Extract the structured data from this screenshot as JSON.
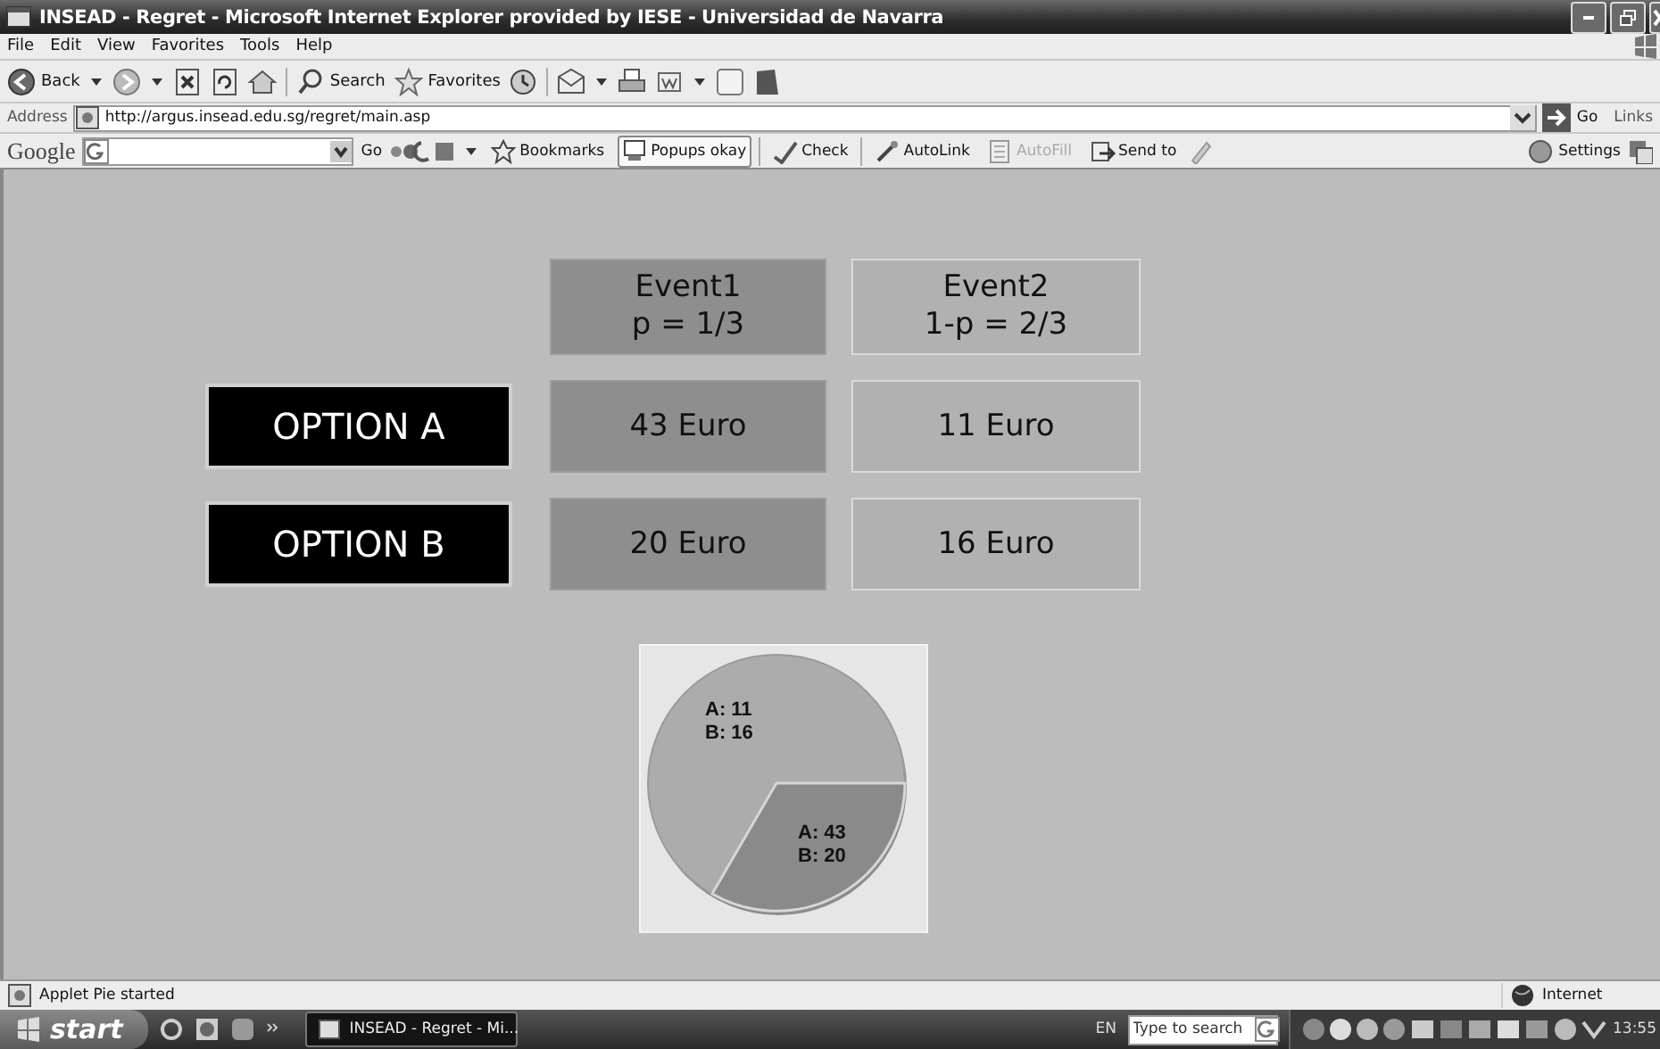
{
  "window": {
    "title": "INSEAD - Regret - Microsoft Internet Explorer provided by IESE - Universidad de Navarra"
  },
  "menu_bar": [
    "File",
    "Edit",
    "View",
    "Favorites",
    "Tools",
    "Help"
  ],
  "toolbar": {
    "back": "Back",
    "search": "Search",
    "favorites": "Favorites"
  },
  "address_bar": {
    "label": "Address",
    "url": "http://argus.insead.edu.sg/regret/main.asp",
    "go": "Go",
    "links": "Links"
  },
  "google_bar": {
    "logo": "Google",
    "go": "Go",
    "items": [
      {
        "label": "Bookmarks",
        "disabled": false,
        "selected": false
      },
      {
        "label": "Popups okay",
        "disabled": false,
        "selected": true
      },
      {
        "label": "Check",
        "disabled": false,
        "selected": false
      },
      {
        "label": "AutoLink",
        "disabled": false,
        "selected": false
      },
      {
        "label": "AutoFill",
        "disabled": true,
        "selected": false
      },
      {
        "label": "Send to",
        "disabled": false,
        "selected": false
      }
    ],
    "settings": "Settings"
  },
  "decision": {
    "events": [
      {
        "name": "Event1",
        "probability": "p = 1/3"
      },
      {
        "name": "Event2",
        "probability": "1-p = 2/3"
      }
    ],
    "options": [
      {
        "label": "OPTION A",
        "payoffs": [
          "43 Euro",
          "11 Euro"
        ]
      },
      {
        "label": "OPTION B",
        "payoffs": [
          "20 Euro",
          "16 Euro"
        ]
      }
    ]
  },
  "pie": {
    "labels": [
      "A: 11\nB: 16",
      "A: 43\nB: 20"
    ]
  },
  "status_bar": {
    "text": "Applet Pie started",
    "zone": "Internet"
  },
  "taskbar": {
    "start": "start",
    "tasks": [
      {
        "label": "INSEAD - Regret - Mi...",
        "selected": true
      }
    ],
    "language": "EN",
    "search_placeholder": "Type to search",
    "clock": "13:55"
  }
}
